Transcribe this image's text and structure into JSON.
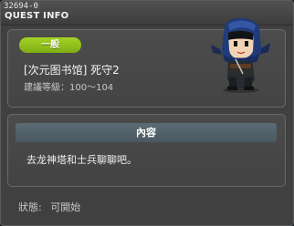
{
  "window": {
    "id": "32694-0",
    "title": "QUEST INFO"
  },
  "quest": {
    "category": "一般",
    "name": "[次元图书馆] 死守2",
    "level_text": "建議等級：100～104",
    "npc_portrait": "hooded-ninja-character"
  },
  "content": {
    "header": "內容",
    "description": "去龙神塔和士兵聊聊吧。"
  },
  "status": {
    "label": "狀態:",
    "value": "可開始"
  },
  "colors": {
    "badge": "#8fbe1b",
    "window_bg": "#404040",
    "content_header": "#53616a"
  }
}
